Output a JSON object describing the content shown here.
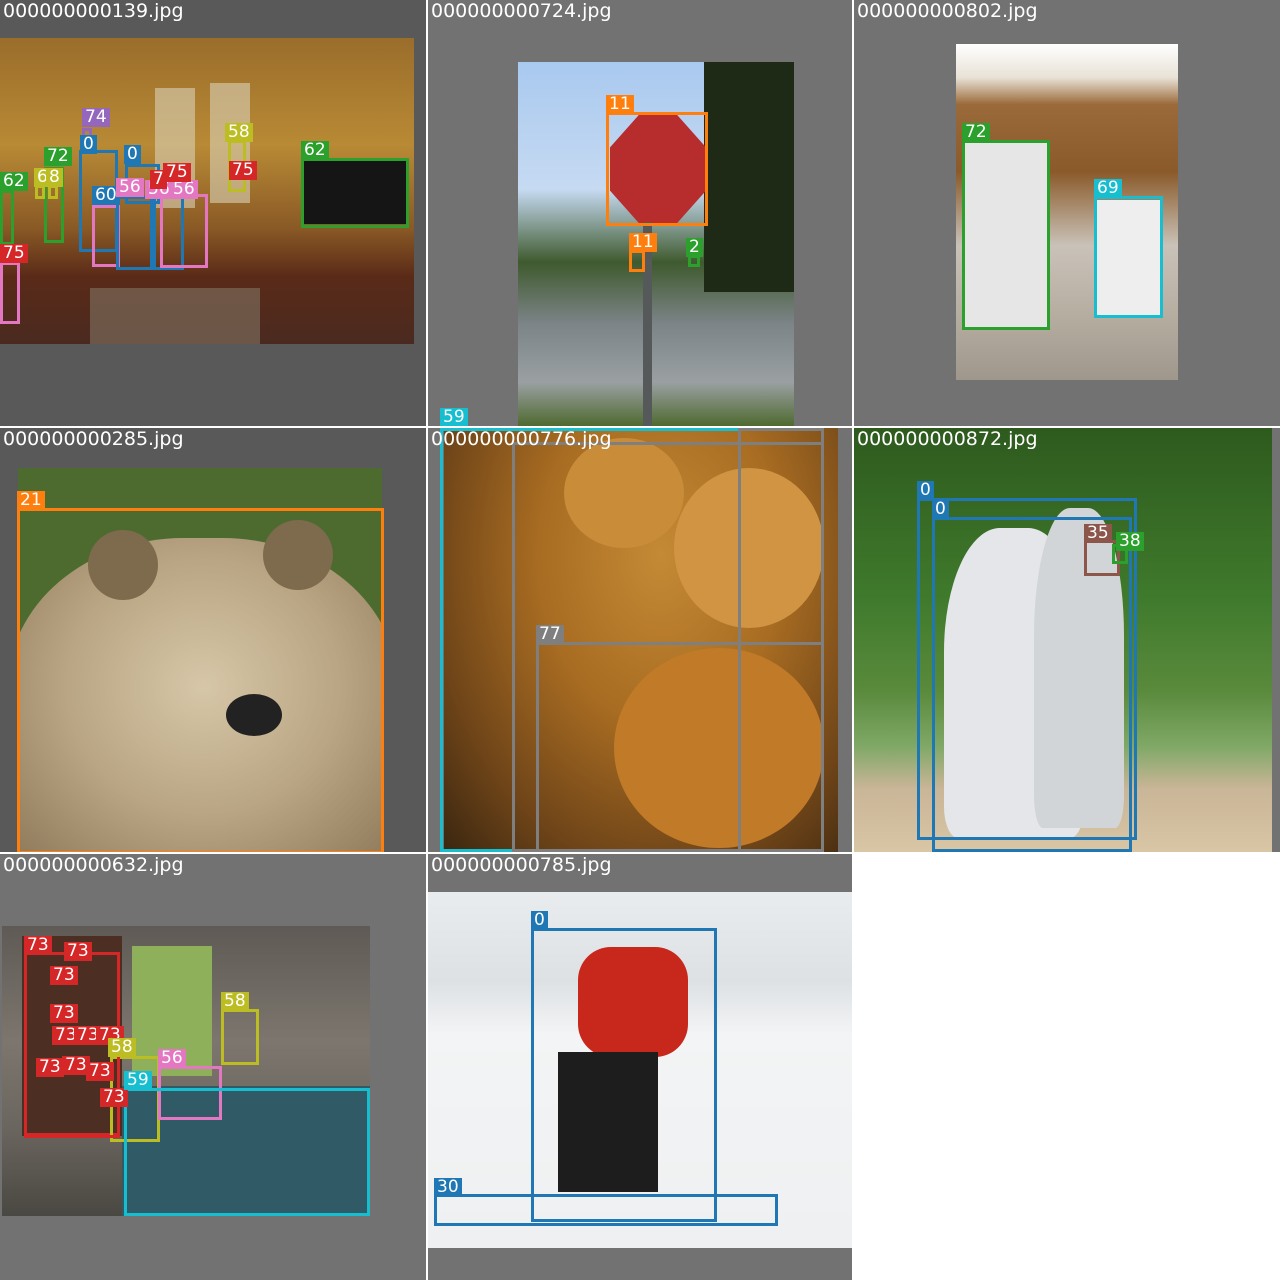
{
  "tiles": [
    {
      "filename": "000000000139.jpg",
      "labels": [
        "74",
        "0",
        "0",
        "72",
        "62",
        "6",
        "8",
        "60",
        "56",
        "56",
        "56",
        "7",
        "75",
        "75",
        "58",
        "62",
        "75"
      ]
    },
    {
      "filename": "000000000724.jpg",
      "labels": [
        "11",
        "11",
        "2",
        "59"
      ]
    },
    {
      "filename": "000000000802.jpg",
      "labels": [
        "72",
        "69"
      ]
    },
    {
      "filename": "000000000285.jpg",
      "labels": [
        "21"
      ]
    },
    {
      "filename": "000000000776.jpg",
      "labels": [
        "77"
      ]
    },
    {
      "filename": "000000000872.jpg",
      "labels": [
        "0",
        "0",
        "35",
        "38"
      ]
    },
    {
      "filename": "000000000632.jpg",
      "labels": [
        "73",
        "73",
        "73",
        "73",
        "73",
        "73",
        "73",
        "73",
        "73",
        "73",
        "73",
        "58",
        "58",
        "56",
        "59",
        "73"
      ]
    },
    {
      "filename": "000000000785.jpg",
      "labels": [
        "0",
        "30"
      ]
    }
  ],
  "colors": {
    "person": "#1f77b4",
    "stop_sign": "#ff7f0e",
    "fire_hydrant": "#2ca02c",
    "bear": "#ff7f0e",
    "teddy_bear": "#17becf",
    "hair_drier": "#7f7f7f",
    "refrigerator": "#2ca02c",
    "oven": "#17becf",
    "tv": "#2ca02c",
    "potted_plant": "#bcbd22",
    "vase": "#d62728",
    "book": "#d62728",
    "chair": "#e377c2",
    "bed": "#17becf",
    "clock": "#9467bd",
    "baseball_glove": "#8c564b",
    "skis": "#1f77b4",
    "tile_bg": "#727272"
  }
}
